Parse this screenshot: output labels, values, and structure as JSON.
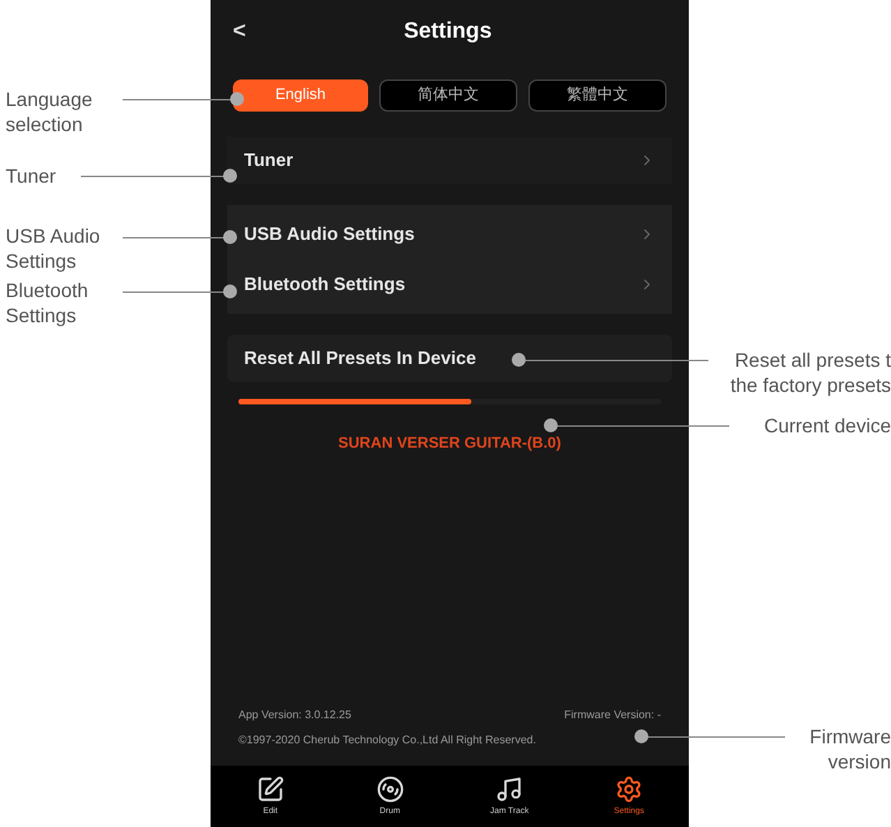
{
  "header": {
    "back": "<",
    "title": "Settings"
  },
  "languages": [
    {
      "label": "English",
      "selected": true
    },
    {
      "label": "简体中文",
      "selected": false
    },
    {
      "label": "繁體中文",
      "selected": false
    }
  ],
  "settings_rows": [
    {
      "label": "Tuner",
      "kind": "single"
    },
    {
      "label": "USB Audio Settings",
      "kind": "paired"
    },
    {
      "label": "Bluetooth Settings",
      "kind": "paired"
    },
    {
      "label": "Reset All Presets In Device",
      "kind": "action"
    }
  ],
  "progress": {
    "level": 0.55
  },
  "current_device": "SURAN VERSER GUITAR-(B.0)",
  "footer": {
    "app_version": "App Version: 3.0.12.25",
    "firmware_version": "Firmware Version: -",
    "copyright": "©1997-2020 Cherub Technology Co.,Ltd All Right Reserved."
  },
  "tab_bar": [
    {
      "label": "Edit",
      "kind": "edit",
      "selected": false
    },
    {
      "label": "Drum",
      "kind": "drum",
      "selected": false
    },
    {
      "label": "Jam Track",
      "kind": "music",
      "selected": false
    },
    {
      "label": "Settings",
      "kind": "gear",
      "selected": true
    }
  ],
  "annotations": [
    {
      "kind": "left",
      "lines": [
        "Language",
        "selection"
      ]
    },
    {
      "kind": "left",
      "lines": [
        "Tuner"
      ]
    },
    {
      "kind": "left",
      "lines": [
        "USB Audio",
        "Settings"
      ]
    },
    {
      "kind": "left",
      "lines": [
        "Bluetooth",
        "Settings"
      ]
    },
    {
      "kind": "right",
      "lines": [
        "Reset all presets t",
        "the factory presets"
      ]
    },
    {
      "kind": "right",
      "lines": [
        "Current device"
      ]
    },
    {
      "kind": "right",
      "lines": [
        "Firmware",
        "version"
      ]
    }
  ]
}
